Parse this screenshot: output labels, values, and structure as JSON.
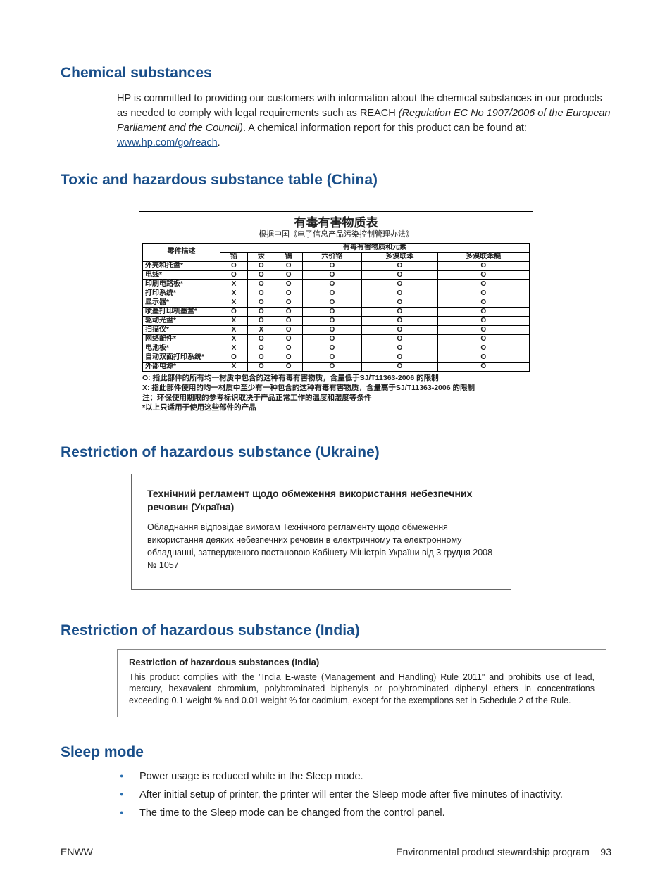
{
  "sections": {
    "chem_title": "Chemical substances",
    "chem_p1a": "HP is committed to providing our customers with information about the chemical substances in our products as needed to comply with legal requirements such as REACH ",
    "chem_reg": "(Regulation EC No 1907/2006 of the European Parliament and the Council)",
    "chem_p1b": ". A chemical information report for this product can be found at: ",
    "chem_link": "www.hp.com/go/reach",
    "chem_p1c": ".",
    "china_title": "Toxic and hazardous substance table (China)",
    "ukr_title": "Restriction of hazardous substance (Ukraine)",
    "india_title": "Restriction of hazardous substance (India)",
    "sleep_title": "Sleep mode"
  },
  "china": {
    "title": "有毒有害物质表",
    "subtitle": "根据中国《电子信息产品污染控制管理办法》",
    "col_part": "零件描述",
    "col_group": "有毒有害物质和元素",
    "cols": [
      "铅",
      "汞",
      "镉",
      "六价铬",
      "多溴联苯",
      "多溴联苯醚"
    ],
    "rows": [
      {
        "name": "外壳和托盘*",
        "v": [
          "O",
          "O",
          "O",
          "O",
          "O",
          "O"
        ]
      },
      {
        "name": "电线*",
        "v": [
          "O",
          "O",
          "O",
          "O",
          "O",
          "O"
        ]
      },
      {
        "name": "印刷电路板*",
        "v": [
          "X",
          "O",
          "O",
          "O",
          "O",
          "O"
        ]
      },
      {
        "name": "打印系统*",
        "v": [
          "X",
          "O",
          "O",
          "O",
          "O",
          "O"
        ]
      },
      {
        "name": "显示器*",
        "v": [
          "X",
          "O",
          "O",
          "O",
          "O",
          "O"
        ]
      },
      {
        "name": "喷墨打印机墨盒*",
        "v": [
          "O",
          "O",
          "O",
          "O",
          "O",
          "O"
        ]
      },
      {
        "name": "驱动光盘*",
        "v": [
          "X",
          "O",
          "O",
          "O",
          "O",
          "O"
        ]
      },
      {
        "name": "扫描仪*",
        "v": [
          "X",
          "X",
          "O",
          "O",
          "O",
          "O"
        ]
      },
      {
        "name": "网络配件*",
        "v": [
          "X",
          "O",
          "O",
          "O",
          "O",
          "O"
        ]
      },
      {
        "name": "电池板*",
        "v": [
          "X",
          "O",
          "O",
          "O",
          "O",
          "O"
        ]
      },
      {
        "name": "自动双面打印系统*",
        "v": [
          "O",
          "O",
          "O",
          "O",
          "O",
          "O"
        ]
      },
      {
        "name": "外部电源*",
        "v": [
          "X",
          "O",
          "O",
          "O",
          "O",
          "O"
        ]
      }
    ],
    "notes": [
      "O: 指此部件的所有均一材质中包含的这种有毒有害物质，含量低于SJ/T11363-2006 的限制",
      "X: 指此部件使用的均一材质中至少有一种包含的这种有毒有害物质，含量高于SJ/T11363-2006 的限制",
      "注：环保使用期限的参考标识取决于产品正常工作的温度和湿度等条件",
      "*以上只适用于使用这些部件的产品"
    ]
  },
  "ukraine": {
    "title": "Технічний регламент щодо обмеження використання небезпечних речовин (Україна)",
    "body": "Обладнання відповідає вимогам Технічного регламенту щодо обмеження використання деяких небезпечних речовин в електричному та електронному обладнанні, затвердженого постановою Кабінету Міністрів України від 3 грудня 2008 № 1057"
  },
  "india": {
    "title": "Restriction of hazardous substances (India)",
    "body": "This product complies with the \"India E-waste (Management and Handling) Rule 2011\" and prohibits use of lead, mercury, hexavalent chromium, polybrominated biphenyls or polybrominated diphenyl ethers in concentrations exceeding 0.1 weight % and 0.01 weight % for cadmium, except for the exemptions set in Schedule 2 of the Rule."
  },
  "sleep": {
    "b1": "Power usage is reduced while in the Sleep mode.",
    "b2": "After initial setup of printer, the printer will enter the Sleep mode after five minutes of inactivity.",
    "b3": "The time to the Sleep mode can be changed from the control panel."
  },
  "footer": {
    "left": "ENWW",
    "right_label": "Environmental product stewardship program",
    "page": "93"
  }
}
